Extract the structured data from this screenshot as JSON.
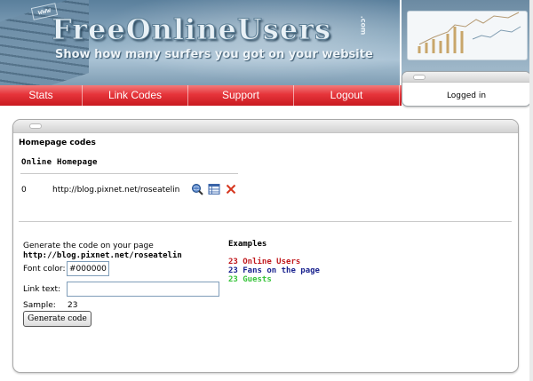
{
  "header": {
    "www": "www",
    "logo": "FreeOnlineUsers",
    "logo_suffix": ".com",
    "slogan": "Show how many surfers you got on your website"
  },
  "login_box": {
    "status": "Logged in"
  },
  "nav": {
    "items": [
      "Stats",
      "Link Codes",
      "Support",
      "Logout"
    ]
  },
  "main": {
    "section_title": "Homepage codes",
    "online_homepage_label": "Online Homepage",
    "row": {
      "index": "0",
      "url": "http://blog.pixnet.net/roseatelin",
      "icons": [
        "view-stats-icon",
        "edit-icon",
        "delete-icon"
      ]
    },
    "generate": {
      "label": "Generate the code on your page",
      "url": "http://blog.pixnet.net/roseatelin",
      "font_color_label": "Font color:",
      "font_color_value": "#000000",
      "link_text_label": "Link text:",
      "link_text_value": "",
      "sample_label": "Sample:",
      "sample_value": "23",
      "button": "Generate code"
    },
    "examples": {
      "title": "Examples",
      "items": [
        {
          "text": "23 Online Users",
          "color": "#c0181c"
        },
        {
          "text": "23 Fans on the page",
          "color": "#1a238f"
        },
        {
          "text": "23 Guests",
          "color": "#37c43a"
        }
      ]
    }
  },
  "colors": {
    "nav_red": "#e6343a",
    "accent_blue": "#6b8aa2"
  }
}
